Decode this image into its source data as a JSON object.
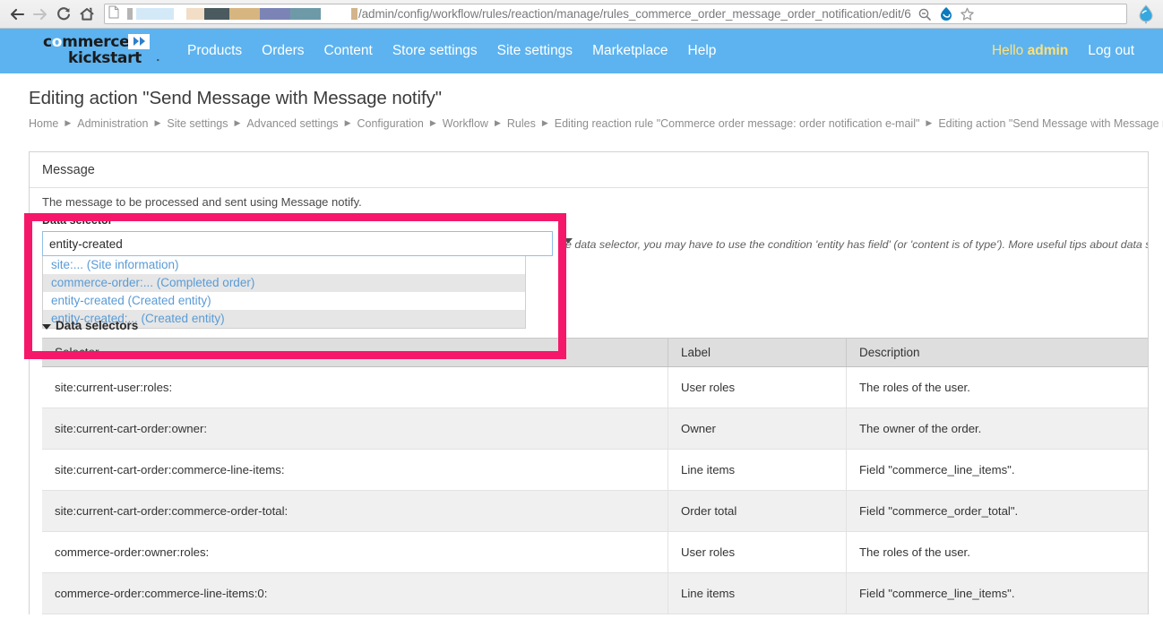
{
  "browser": {
    "back_icon": "back-arrow-icon",
    "forward_icon": "forward-arrow-icon",
    "reload_icon": "reload-icon",
    "home_icon": "home-icon",
    "page_icon": "page-document-icon",
    "url_text": "/admin/config/workflow/rules/reaction/manage/rules_commerce_order_message_order_notification/edit/6",
    "url_redacted_note": "redacted-host",
    "zoom_out_icon": "zoom-out-icon",
    "drupal_icon": "drupal-droplet-icon",
    "bookmark_icon": "star-bookmark-icon",
    "extension_icon": "blue-droplet-extension-icon"
  },
  "header": {
    "logo": {
      "line1_pre": "c",
      "line1_o": "o",
      "line1_post": "mmerce",
      "line2": "kickstart",
      "tm": "˚",
      "arrows_icon": "double-arrow-icon"
    },
    "nav": [
      {
        "label": "Products"
      },
      {
        "label": "Orders"
      },
      {
        "label": "Content"
      },
      {
        "label": "Store settings"
      },
      {
        "label": "Site settings"
      },
      {
        "label": "Marketplace"
      },
      {
        "label": "Help"
      }
    ],
    "user": {
      "hello_prefix": "Hello ",
      "username": "admin",
      "logout": "Log out"
    }
  },
  "page": {
    "title": "Editing action \"Send Message with Message notify\"",
    "breadcrumb": [
      "Home",
      "Administration",
      "Site settings",
      "Advanced settings",
      "Configuration",
      "Workflow",
      "Rules",
      "Editing reaction rule \"Commerce order message: order notification e-mail\"",
      "Editing action \"Send Message with Message notify\""
    ]
  },
  "panel": {
    "heading": "Message",
    "description": "The message to be processed and sent using Message notify.",
    "field": {
      "label": "Data selector",
      "required_marker": "*",
      "value": "entity-created",
      "placeholder": "",
      "dropdown_icon": "chevron-down-icon"
    },
    "help_text": "e data selector, you may have to use the condition 'entity has field' (or 'content is of type'). More useful tips about data selection is",
    "suggestions": [
      {
        "text": "site:... (Site information)"
      },
      {
        "text": "commerce-order:... (Completed order)"
      },
      {
        "text": "entity-created (Created entity)"
      },
      {
        "text": "entity-created:... (Created entity)"
      }
    ],
    "data_selectors_toggle": "Data selectors"
  },
  "table": {
    "columns": [
      "Selector",
      "Label",
      "Description"
    ],
    "rows": [
      [
        "site:current-user:roles:",
        "User roles",
        "The roles of the user."
      ],
      [
        "site:current-cart-order:owner:",
        "Owner",
        "The owner of the order."
      ],
      [
        "site:current-cart-order:commerce-line-items:",
        "Line items",
        "Field \"commerce_line_items\"."
      ],
      [
        "site:current-cart-order:commerce-order-total:",
        "Order total",
        "Field \"commerce_order_total\"."
      ],
      [
        "commerce-order:owner:roles:",
        "User roles",
        "The roles of the user."
      ],
      [
        "commerce-order:commerce-line-items:0:",
        "Line items",
        "Field \"commerce_line_items\"."
      ]
    ]
  },
  "annotation": {
    "highlight_color": "#f5176a"
  }
}
